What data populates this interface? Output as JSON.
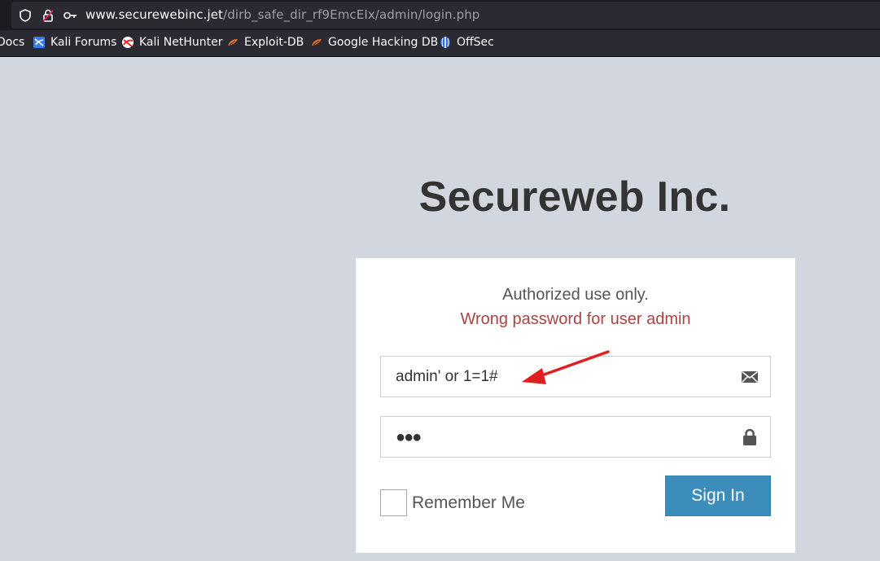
{
  "browser": {
    "url": {
      "host": "www.securewebinc.jet",
      "path": "/dirb_safe_dir_rf9EmcEIx/admin/login.php"
    },
    "bookmarks": [
      {
        "label": "Docs",
        "icon": "kali-docs-icon"
      },
      {
        "label": "Kali Forums",
        "icon": "kali-forums-icon"
      },
      {
        "label": "Kali NetHunter",
        "icon": "nethunter-icon"
      },
      {
        "label": "Exploit-DB",
        "icon": "exploit-db-icon"
      },
      {
        "label": "Google Hacking DB",
        "icon": "ghdb-icon"
      },
      {
        "label": "OffSec",
        "icon": "offsec-icon"
      }
    ]
  },
  "page": {
    "brand": "Secureweb Inc.",
    "login": {
      "info_message": "Authorized use only.",
      "error_message": "Wrong password for user admin",
      "username_value": "admin' or 1=1#",
      "password_value": "●●●",
      "remember_label": "Remember Me",
      "signin_label": "Sign In"
    }
  },
  "colors": {
    "page_bg": "#d2d6de",
    "error": "#a94442",
    "button": "#3c8dbc",
    "annotation_arrow": "#e0201f"
  }
}
